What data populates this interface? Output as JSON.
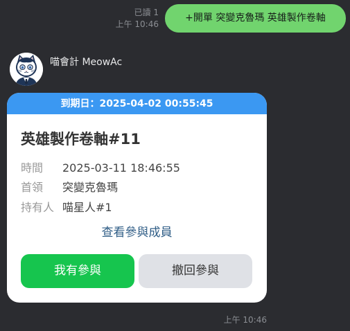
{
  "outgoing_message": {
    "read_status": "已讀 1",
    "time": "上午 10:46",
    "text": "+開單 突變克魯瑪 英雄製作卷軸"
  },
  "incoming_message": {
    "sender_name": "喵會計 MeowAc",
    "avatar_icon": "cat-accountant-avatar",
    "time": "上午 10:46",
    "card": {
      "header": "到期日：2025-04-02 00:55:45",
      "header_color": "#3b98f2",
      "title": "英雄製作卷軸#11",
      "details": [
        {
          "label": "時間",
          "value": "2025-03-11 18:46:55"
        },
        {
          "label": "首領",
          "value": "突變克魯瑪"
        },
        {
          "label": "持有人",
          "value": "喵星人#1"
        }
      ],
      "view_members_link": "查看參與成員",
      "join_button": "我有參與",
      "join_button_color": "#16c54e",
      "withdraw_button": "撤回參與",
      "withdraw_button_color": "#dfe1e6"
    }
  }
}
